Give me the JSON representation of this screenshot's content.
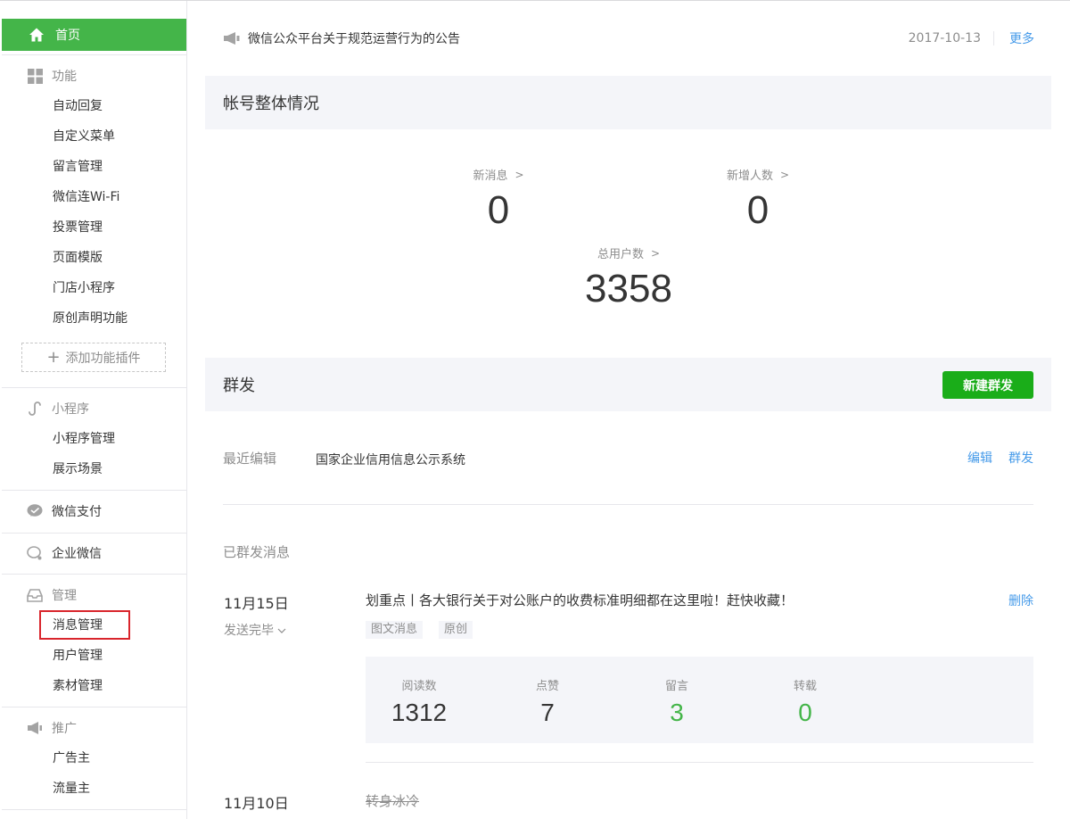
{
  "sidebar": {
    "home": {
      "label": "首页",
      "icon": "home-icon"
    },
    "features": {
      "title": "功能",
      "items": [
        "自动回复",
        "自定义菜单",
        "留言管理",
        "微信连Wi-Fi",
        "投票管理",
        "页面模版",
        "门店小程序",
        "原创声明功能"
      ],
      "add_plugin": "添加功能插件"
    },
    "miniprogram": {
      "title": "小程序",
      "items": [
        "小程序管理",
        "展示场景"
      ]
    },
    "pay": {
      "title": "微信支付"
    },
    "work": {
      "title": "企业微信"
    },
    "manage": {
      "title": "管理",
      "items": [
        "消息管理",
        "用户管理",
        "素材管理"
      ],
      "active": "消息管理"
    },
    "promo": {
      "title": "推广",
      "items": [
        "广告主",
        "流量主"
      ]
    }
  },
  "notice": {
    "text": "微信公众平台关于规范运营行为的公告",
    "date": "2017-10-13",
    "more": "更多"
  },
  "overview": {
    "title": "帐号整体情况",
    "new_messages_label": "新消息",
    "new_messages": "0",
    "new_users_label": "新增人数",
    "new_users": "0",
    "total_users_label": "总用户数",
    "total_users": "3358"
  },
  "mass": {
    "title": "群发",
    "new_button": "新建群发",
    "recent_label": "最近编辑",
    "recent_title": "国家企业信用信息公示系统",
    "edit": "编辑",
    "send": "群发",
    "sent_heading": "已群发消息"
  },
  "messages": [
    {
      "date": "11月15日",
      "status": "发送完毕",
      "title": "划重点丨各大银行关于对公账户的收费标准明细都在这里啦！赶快收藏！",
      "tags": [
        "图文消息",
        "原创"
      ],
      "delete": "删除",
      "metrics": {
        "reads_label": "阅读数",
        "reads": "1312",
        "likes_label": "点赞",
        "likes": "7",
        "comments_label": "留言",
        "comments": "3",
        "reposts_label": "转载",
        "reposts": "0"
      }
    },
    {
      "date": "11月10日",
      "title": "转身冰冷"
    }
  ],
  "colors": {
    "brand_green": "#44b549",
    "button_green": "#1aad19",
    "link_blue": "#459ae9",
    "highlight_red": "#d9252c"
  }
}
